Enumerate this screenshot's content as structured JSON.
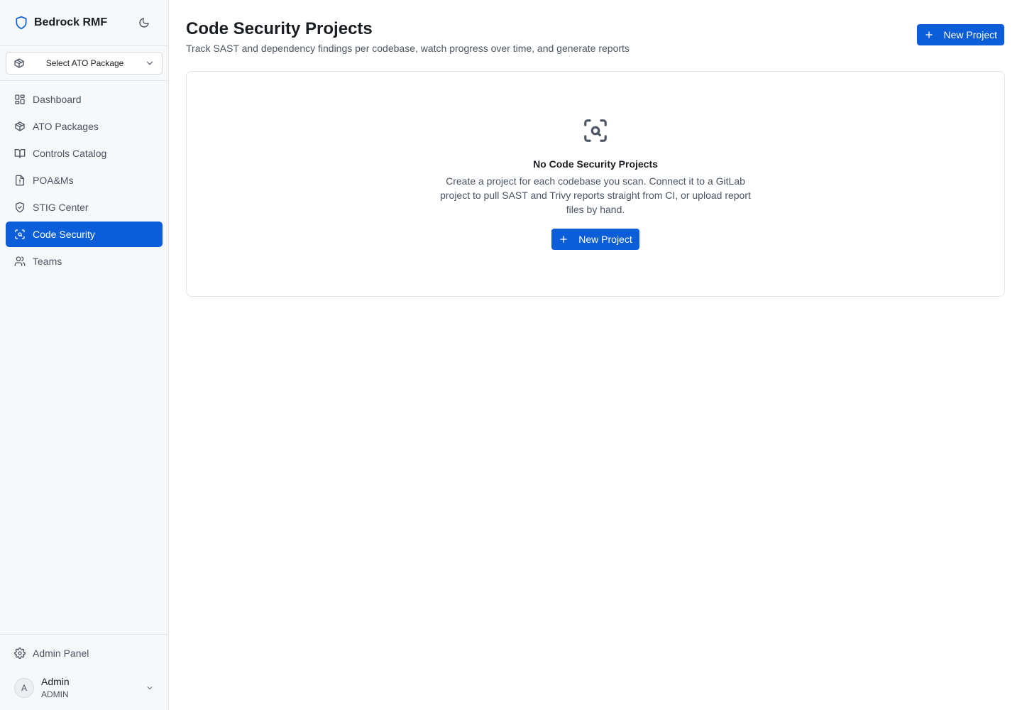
{
  "brand": {
    "name": "Bedrock RMF"
  },
  "package_select": {
    "label": "Select ATO Package"
  },
  "nav": [
    {
      "label": "Dashboard",
      "icon": "dashboard-icon"
    },
    {
      "label": "ATO Packages",
      "icon": "package-icon"
    },
    {
      "label": "Controls Catalog",
      "icon": "book-icon"
    },
    {
      "label": "POA&Ms",
      "icon": "file-alert-icon"
    },
    {
      "label": "STIG Center",
      "icon": "shield-check-icon"
    },
    {
      "label": "Code Security",
      "icon": "scan-search-icon",
      "active": true
    },
    {
      "label": "Teams",
      "icon": "users-icon"
    }
  ],
  "admin_panel": {
    "label": "Admin Panel"
  },
  "user": {
    "initial": "A",
    "name": "Admin",
    "role": "ADMIN"
  },
  "page": {
    "title": "Code Security Projects",
    "subtitle": "Track SAST and dependency findings per codebase, watch progress over time, and generate reports",
    "new_project_label": "New Project"
  },
  "empty_state": {
    "title": "No Code Security Projects",
    "description": "Create a project for each codebase you scan. Connect it to a GitLab project to pull SAST and Trivy reports straight from CI, or upload report files by hand.",
    "button_label": "New Project"
  },
  "colors": {
    "accent": "#0b5ed7",
    "sidebar_bg": "#f7f8f9",
    "border": "#e3e5e8"
  }
}
